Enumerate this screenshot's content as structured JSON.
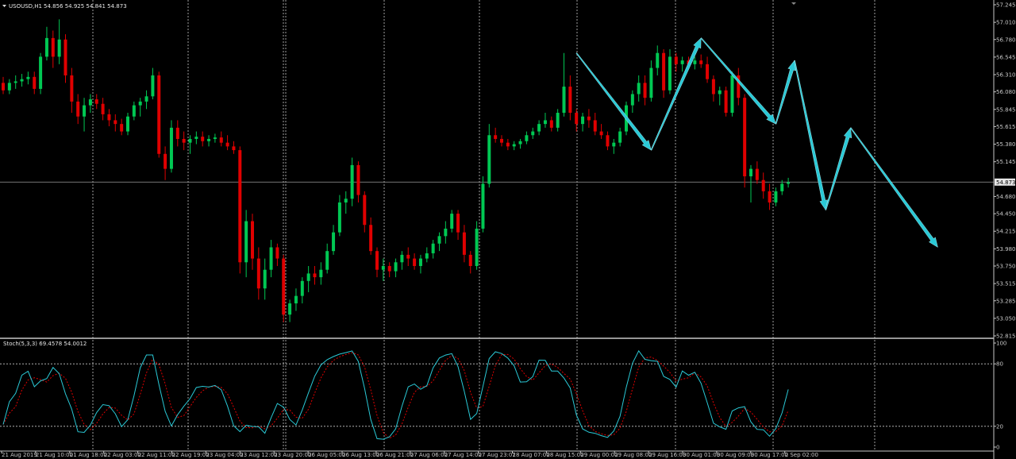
{
  "header": {
    "symbol": "USOUSD,H1",
    "ohlc": "54.856 54.925 54.841 54.873"
  },
  "colors": {
    "background": "#000000",
    "bull": "#00c853",
    "bear": "#e00000",
    "grid": "#c8c8c8",
    "text": "#c8c8c8",
    "arrow": "#2ac9d6",
    "stoch_main": "#2ac9d6",
    "stoch_signal": "#e00000"
  },
  "price_axis": {
    "ticks": [
      "57.245",
      "57.010",
      "56.780",
      "56.545",
      "56.310",
      "56.080",
      "55.845",
      "55.615",
      "55.380",
      "55.145",
      "54.680",
      "54.450",
      "54.215",
      "53.980",
      "53.750",
      "53.515",
      "53.285",
      "53.050",
      "52.815"
    ],
    "current": "54.873"
  },
  "stoch": {
    "label": "Stoch(5,3,3) 69.4578 54.0012",
    "ticks": [
      "100",
      "80",
      "20",
      "0"
    ]
  },
  "time_axis": [
    "21 Aug 2019",
    "21 Aug 10:00",
    "21 Aug 18:00",
    "22 Aug 03:00",
    "22 Aug 11:00",
    "22 Aug 19:00",
    "23 Aug 04:00",
    "23 Aug 12:00",
    "23 Aug 20:00",
    "26 Aug 05:00",
    "26 Aug 13:00",
    "26 Aug 21:00",
    "27 Aug 06:00",
    "27 Aug 14:00",
    "27 Aug 23:01",
    "28 Aug 07:00",
    "28 Aug 15:00",
    "29 Aug 00:00",
    "29 Aug 08:00",
    "29 Aug 16:00",
    "30 Aug 01:00",
    "30 Aug 09:00",
    "30 Aug 17:00",
    "2 Sep 02:00"
  ],
  "chart_data": {
    "type": "candlestick",
    "ylim": [
      52.815,
      57.245
    ],
    "current_price": 54.873,
    "candles": [
      [
        56.2,
        56.28,
        56.05,
        56.1
      ],
      [
        56.1,
        56.25,
        56.05,
        56.2
      ],
      [
        56.2,
        56.3,
        56.12,
        56.22
      ],
      [
        56.22,
        56.32,
        56.15,
        56.25
      ],
      [
        56.25,
        56.35,
        56.18,
        56.28
      ],
      [
        56.28,
        56.35,
        56.05,
        56.12
      ],
      [
        56.12,
        56.6,
        56.05,
        56.55
      ],
      [
        56.55,
        56.95,
        56.5,
        56.8
      ],
      [
        56.8,
        56.9,
        56.4,
        56.55
      ],
      [
        56.55,
        57.05,
        56.45,
        56.78
      ],
      [
        56.78,
        56.85,
        56.2,
        56.3
      ],
      [
        56.3,
        56.4,
        55.8,
        55.95
      ],
      [
        55.95,
        56.05,
        55.65,
        55.75
      ],
      [
        55.75,
        56.0,
        55.55,
        55.9
      ],
      [
        55.9,
        56.05,
        55.8,
        55.98
      ],
      [
        55.98,
        56.05,
        55.85,
        55.92
      ],
      [
        55.92,
        56.0,
        55.7,
        55.78
      ],
      [
        55.78,
        55.85,
        55.62,
        55.7
      ],
      [
        55.7,
        55.78,
        55.55,
        55.65
      ],
      [
        55.65,
        55.72,
        55.5,
        55.55
      ],
      [
        55.55,
        55.8,
        55.5,
        55.75
      ],
      [
        55.75,
        55.95,
        55.7,
        55.9
      ],
      [
        55.9,
        56.0,
        55.75,
        55.95
      ],
      [
        55.95,
        56.1,
        55.85,
        56.02
      ],
      [
        56.02,
        56.4,
        55.98,
        56.3
      ],
      [
        56.3,
        56.35,
        55.2,
        55.25
      ],
      [
        55.25,
        55.35,
        54.9,
        55.05
      ],
      [
        55.05,
        55.7,
        55.0,
        55.6
      ],
      [
        55.6,
        55.7,
        55.35,
        55.45
      ],
      [
        55.45,
        55.55,
        55.3,
        55.4
      ],
      [
        55.4,
        55.5,
        55.25,
        55.45
      ],
      [
        55.45,
        55.55,
        55.38,
        55.48
      ],
      [
        55.48,
        55.55,
        55.35,
        55.42
      ],
      [
        55.42,
        55.5,
        55.35,
        55.45
      ],
      [
        55.45,
        55.52,
        55.4,
        55.47
      ],
      [
        55.47,
        55.55,
        55.35,
        55.4
      ],
      [
        55.4,
        55.5,
        55.3,
        55.35
      ],
      [
        55.35,
        55.42,
        55.25,
        55.3
      ],
      [
        55.3,
        55.35,
        53.65,
        53.8
      ],
      [
        53.8,
        54.5,
        53.6,
        54.35
      ],
      [
        54.35,
        54.45,
        53.7,
        53.85
      ],
      [
        53.85,
        54.0,
        53.3,
        53.45
      ],
      [
        53.45,
        53.85,
        53.3,
        53.7
      ],
      [
        53.7,
        54.1,
        53.6,
        54.0
      ],
      [
        54.0,
        54.05,
        53.75,
        53.85
      ],
      [
        53.85,
        53.9,
        53.0,
        53.1
      ],
      [
        53.1,
        53.3,
        53.0,
        53.25
      ],
      [
        53.25,
        53.45,
        53.15,
        53.35
      ],
      [
        53.35,
        53.6,
        53.25,
        53.55
      ],
      [
        53.55,
        53.75,
        53.4,
        53.65
      ],
      [
        53.65,
        53.75,
        53.5,
        53.6
      ],
      [
        53.6,
        53.8,
        53.5,
        53.7
      ],
      [
        53.7,
        54.05,
        53.65,
        53.95
      ],
      [
        53.95,
        54.3,
        53.9,
        54.2
      ],
      [
        54.2,
        54.7,
        54.15,
        54.6
      ],
      [
        54.6,
        54.75,
        54.45,
        54.65
      ],
      [
        54.65,
        55.2,
        54.55,
        55.1
      ],
      [
        55.1,
        55.15,
        54.6,
        54.7
      ],
      [
        54.7,
        54.75,
        54.2,
        54.3
      ],
      [
        54.3,
        54.4,
        53.9,
        53.95
      ],
      [
        53.95,
        54.0,
        53.6,
        53.7
      ],
      [
        53.7,
        53.85,
        53.55,
        53.75
      ],
      [
        53.75,
        53.8,
        53.6,
        53.68
      ],
      [
        53.68,
        53.85,
        53.6,
        53.8
      ],
      [
        53.8,
        53.95,
        53.7,
        53.9
      ],
      [
        53.9,
        54.0,
        53.75,
        53.85
      ],
      [
        53.85,
        53.92,
        53.7,
        53.75
      ],
      [
        53.75,
        53.9,
        53.65,
        53.85
      ],
      [
        53.85,
        54.0,
        53.8,
        53.92
      ],
      [
        53.92,
        54.1,
        53.85,
        54.05
      ],
      [
        54.05,
        54.2,
        53.95,
        54.15
      ],
      [
        54.15,
        54.35,
        54.05,
        54.25
      ],
      [
        54.25,
        54.5,
        54.2,
        54.45
      ],
      [
        54.45,
        54.5,
        54.1,
        54.2
      ],
      [
        54.2,
        54.3,
        53.8,
        53.9
      ],
      [
        53.9,
        53.95,
        53.65,
        53.75
      ],
      [
        53.75,
        54.35,
        53.7,
        54.25
      ],
      [
        54.25,
        54.95,
        54.2,
        54.85
      ],
      [
        54.85,
        55.65,
        54.8,
        55.5
      ],
      [
        55.5,
        55.6,
        55.4,
        55.45
      ],
      [
        55.45,
        55.5,
        55.35,
        55.4
      ],
      [
        55.4,
        55.45,
        55.3,
        55.35
      ],
      [
        55.35,
        55.42,
        55.3,
        55.38
      ],
      [
        55.38,
        55.45,
        55.32,
        55.42
      ],
      [
        55.42,
        55.55,
        55.38,
        55.5
      ],
      [
        55.5,
        55.6,
        55.45,
        55.55
      ],
      [
        55.55,
        55.7,
        55.5,
        55.65
      ],
      [
        55.65,
        55.8,
        55.6,
        55.7
      ],
      [
        55.7,
        55.75,
        55.55,
        55.6
      ],
      [
        55.6,
        55.85,
        55.55,
        55.8
      ],
      [
        55.8,
        56.6,
        55.75,
        56.15
      ],
      [
        56.15,
        56.3,
        55.7,
        55.8
      ],
      [
        55.8,
        55.85,
        55.55,
        55.65
      ],
      [
        55.65,
        55.8,
        55.55,
        55.75
      ],
      [
        55.75,
        55.85,
        55.6,
        55.7
      ],
      [
        55.7,
        55.8,
        55.5,
        55.55
      ],
      [
        55.55,
        55.65,
        55.45,
        55.5
      ],
      [
        55.5,
        55.55,
        55.3,
        55.35
      ],
      [
        55.35,
        55.45,
        55.25,
        55.4
      ],
      [
        55.4,
        55.6,
        55.35,
        55.55
      ],
      [
        55.55,
        55.95,
        55.5,
        55.9
      ],
      [
        55.9,
        56.1,
        55.8,
        56.05
      ],
      [
        56.05,
        56.3,
        55.95,
        56.2
      ],
      [
        56.2,
        56.3,
        55.9,
        56.0
      ],
      [
        56.0,
        56.5,
        55.95,
        56.4
      ],
      [
        56.4,
        56.7,
        56.3,
        56.6
      ],
      [
        56.6,
        56.65,
        56.0,
        56.1
      ],
      [
        56.1,
        56.65,
        56.05,
        56.55
      ],
      [
        56.55,
        56.6,
        56.35,
        56.45
      ],
      [
        56.45,
        56.55,
        56.35,
        56.5
      ],
      [
        56.5,
        56.55,
        56.4,
        56.45
      ],
      [
        56.45,
        56.55,
        56.38,
        56.5
      ],
      [
        56.5,
        56.58,
        56.4,
        56.45
      ],
      [
        56.45,
        56.55,
        56.2,
        56.25
      ],
      [
        56.25,
        56.3,
        55.95,
        56.05
      ],
      [
        56.05,
        56.15,
        55.9,
        56.1
      ],
      [
        56.1,
        56.15,
        55.75,
        55.8
      ],
      [
        55.8,
        56.35,
        55.75,
        56.3
      ],
      [
        56.3,
        56.4,
        55.9,
        56.0
      ],
      [
        56.0,
        56.05,
        54.8,
        54.95
      ],
      [
        54.95,
        55.1,
        54.6,
        55.05
      ],
      [
        55.05,
        55.15,
        54.85,
        54.9
      ],
      [
        54.9,
        55.0,
        54.65,
        54.75
      ],
      [
        54.75,
        54.85,
        54.5,
        54.6
      ],
      [
        54.6,
        54.8,
        54.55,
        54.75
      ],
      [
        54.75,
        54.9,
        54.7,
        54.85
      ],
      [
        54.85,
        54.93,
        54.8,
        54.87
      ]
    ],
    "arrows": [
      {
        "from": [
          92,
          56.6
        ],
        "to": [
          104,
          55.3
        ]
      },
      {
        "from": [
          104,
          55.3
        ],
        "to": [
          112,
          56.8
        ]
      },
      {
        "from": [
          112,
          56.8
        ],
        "to": [
          124,
          55.65
        ]
      },
      {
        "from": [
          124,
          55.65
        ],
        "to": [
          127,
          56.5
        ]
      },
      {
        "from": [
          127,
          56.5
        ],
        "to": [
          132,
          54.5
        ]
      },
      {
        "from": [
          132,
          54.5
        ],
        "to": [
          136,
          55.6
        ]
      },
      {
        "from": [
          136,
          55.6
        ],
        "to": [
          150,
          54.0
        ]
      }
    ],
    "stochastic": {
      "ylim": [
        0,
        100
      ],
      "levels": [
        80,
        20
      ],
      "main_last": 69.4578,
      "signal_last": 54.0012
    }
  }
}
